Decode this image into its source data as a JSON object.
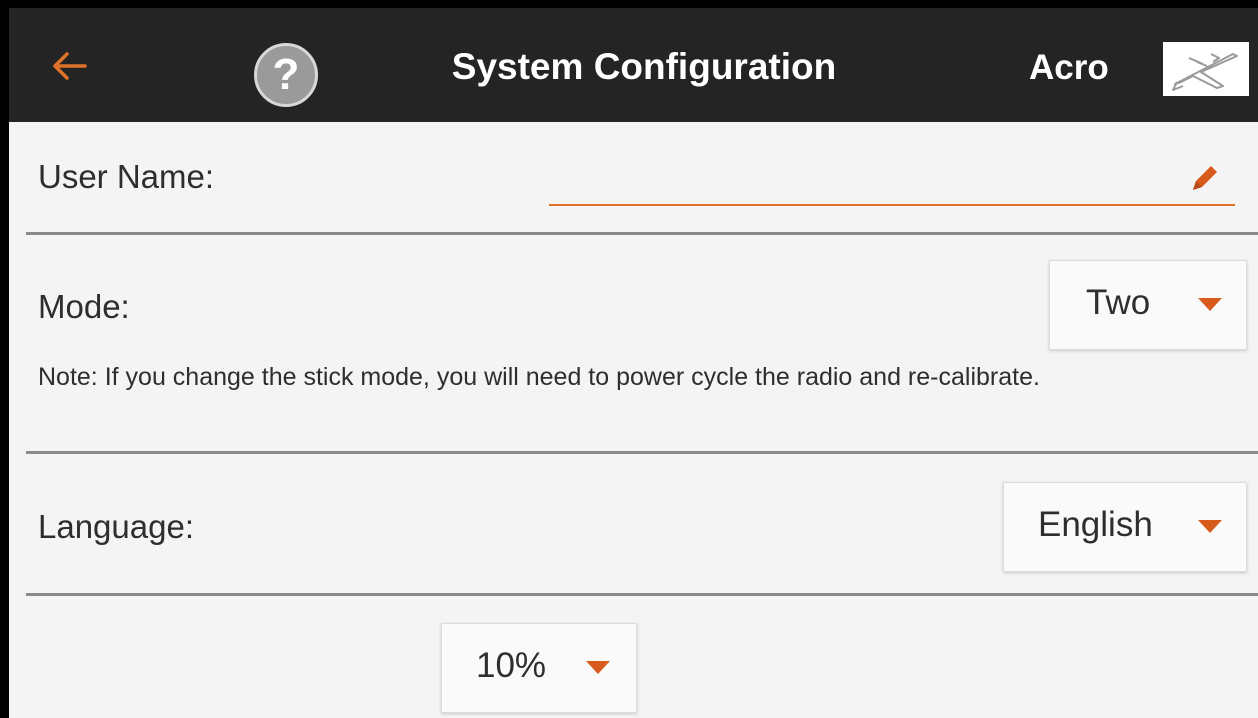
{
  "header": {
    "title": "System Configuration",
    "model_name": "Acro",
    "back_icon": "back-arrow-icon",
    "help_icon": "question-mark-icon",
    "help_glyph": "?",
    "model_type_icon": "airplane-icon"
  },
  "user_name": {
    "label": "User Name:",
    "value": "",
    "edit_icon": "pencil-icon"
  },
  "mode": {
    "label": "Mode:",
    "value": "Two",
    "note": "Note: If you change the stick mode, you will need to power cycle the radio and re-calibrate."
  },
  "language": {
    "label": "Language:",
    "value": "English"
  },
  "battery_alarm": {
    "value": "10%"
  },
  "colors": {
    "header_bg": "#242424",
    "accent": "#d85a1c",
    "background": "#f4f4f4",
    "text": "#2e2e2e"
  }
}
